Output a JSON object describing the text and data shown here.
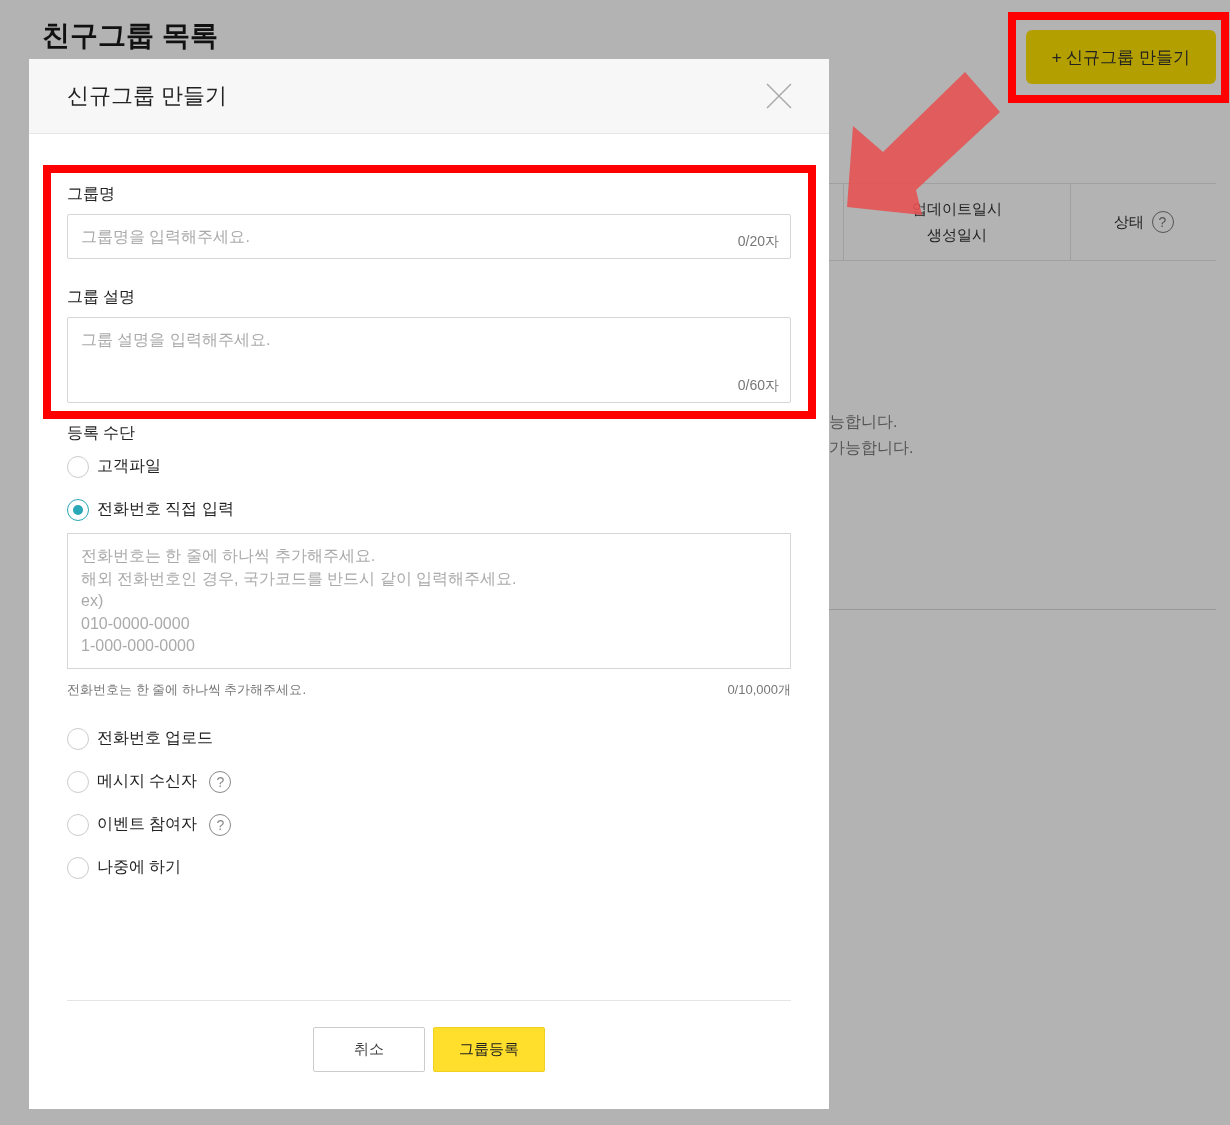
{
  "page": {
    "title": "친구그룹 목록",
    "create_button": "+ 신규그룹 만들기",
    "table_columns": [
      {
        "lines": [
          "업데이트일시",
          "생성일시"
        ]
      },
      {
        "lines": [
          "상태"
        ],
        "help": "?"
      }
    ],
    "notices": [
      "능합니다.",
      "가능합니다."
    ]
  },
  "modal": {
    "title": "신규그룹 만들기",
    "fields": [
      {
        "kind": "input",
        "label": "그룹명",
        "placeholder": "그룹명을 입력해주세요.",
        "counter": "0/20자"
      },
      {
        "kind": "textarea",
        "label": "그룹 설명",
        "placeholder": "그룹 설명을 입력해주세요.",
        "counter": "0/60자"
      }
    ],
    "registration": {
      "label": "등록 수단",
      "options": [
        {
          "label": "고객파일",
          "selected": false
        },
        {
          "label": "전화번호 직접 입력",
          "selected": true,
          "entry": {
            "placeholder": "전화번호는 한 줄에 하나씩 추가해주세요.\n해외 전화번호인 경우, 국가코드를 반드시 같이 입력해주세요.\nex)\n010-0000-0000\n1-000-000-0000",
            "hint": "전화번호는 한 줄에 하나씩 추가해주세요.",
            "counter": "0/10,000개"
          }
        },
        {
          "label": "전화번호 업로드",
          "selected": false
        },
        {
          "label": "메시지 수신자",
          "selected": false,
          "help": "?"
        },
        {
          "label": "이벤트 참여자",
          "selected": false,
          "help": "?"
        },
        {
          "label": "나중에 하기",
          "selected": false
        }
      ]
    },
    "buttons": [
      {
        "kind": "secondary",
        "label": "취소"
      },
      {
        "kind": "primary",
        "label": "그룹등록"
      }
    ]
  }
}
